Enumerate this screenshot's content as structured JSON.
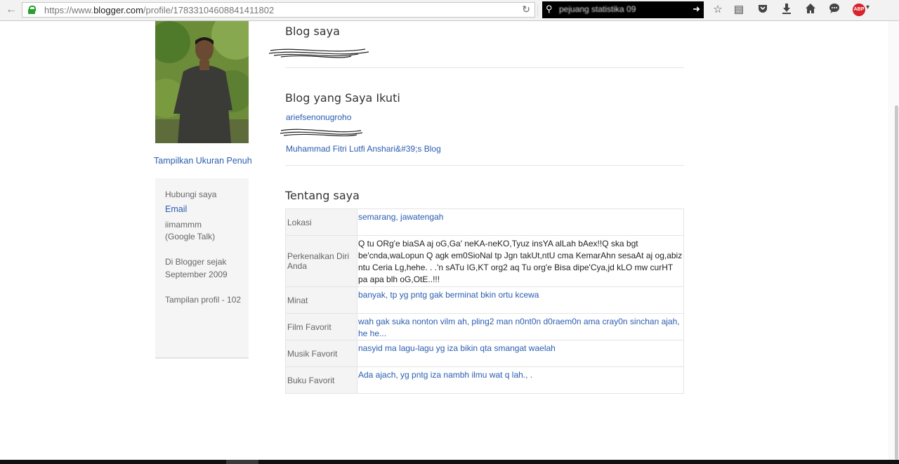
{
  "browser": {
    "url_prefix": "https://www.",
    "url_domain": "blogger.com",
    "url_path": "/profile/17833104608841411802",
    "search_text": "pejuang statistika 09"
  },
  "profile": {
    "view_full_size": "Tampilkan Ukuran Penuh",
    "contact_label": "Hubungi saya",
    "email_label": "Email",
    "im_name": "iimammm",
    "im_service": "(Google Talk)",
    "since_line1": "Di Blogger sejak",
    "since_line2": "September 2009",
    "views_label": "Tampilan profil - 102"
  },
  "sections": {
    "my_blogs": "Blog saya",
    "followed_blogs": "Blog yang Saya Ikuti",
    "about_me": "Tentang saya"
  },
  "followed": [
    "ariefsenonugroho",
    "Muhammad Fitri Lutfi Anshari&#39;s Blog"
  ],
  "about": {
    "location_label": "Lokasi",
    "location_value": "semarang, jawatengah",
    "intro_label": "Perkenalkan Diri Anda",
    "intro_value": "Q tu ORg'e biaSA aj oG,Ga' neKA-neKO,Tyuz insYA alLah bAex!!Q ska bgt be'cnda,waLopun Q agk em0SioNal tp Jgn takUt,ntU cma KemarAhn sesaAt aj og,abiz ntu Ceria Lg,hehe. . .'n sATu IG,KT org2 aq Tu org'e Bisa dipe'Cya,jd kLO mw curHT pa apa blh oG,OtE..!!!",
    "interests_label": "Minat",
    "interests_value": "banyak, tp yg pntg gak berminat bkin ortu kcewa",
    "movies_label": "Film Favorit",
    "movies_value": "wah gak suka nonton vilm ah, pling2 man n0nt0n d0raem0n ama cray0n sinchan ajah, he he...",
    "music_label": "Musik Favorit",
    "music_value": "nasyid ma lagu-lagu yg iza bikin qta smangat waelah",
    "books_label": "Buku Favorit",
    "books_value": "Ada ajach, yg pntg iza nambh ilmu wat q lah., ."
  },
  "colors": {
    "link": "#2a5db0",
    "abp_red": "#d8242b",
    "lock_green": "#27a02f"
  },
  "icons": [
    "back-arrow-icon",
    "lock-icon",
    "reload-icon",
    "search-icon",
    "go-arrow-icon",
    "bookmark-star-icon",
    "reading-list-icon",
    "pocket-icon",
    "download-icon",
    "home-icon",
    "chat-icon",
    "adblock-plus-icon"
  ],
  "abp_text": "ABP"
}
